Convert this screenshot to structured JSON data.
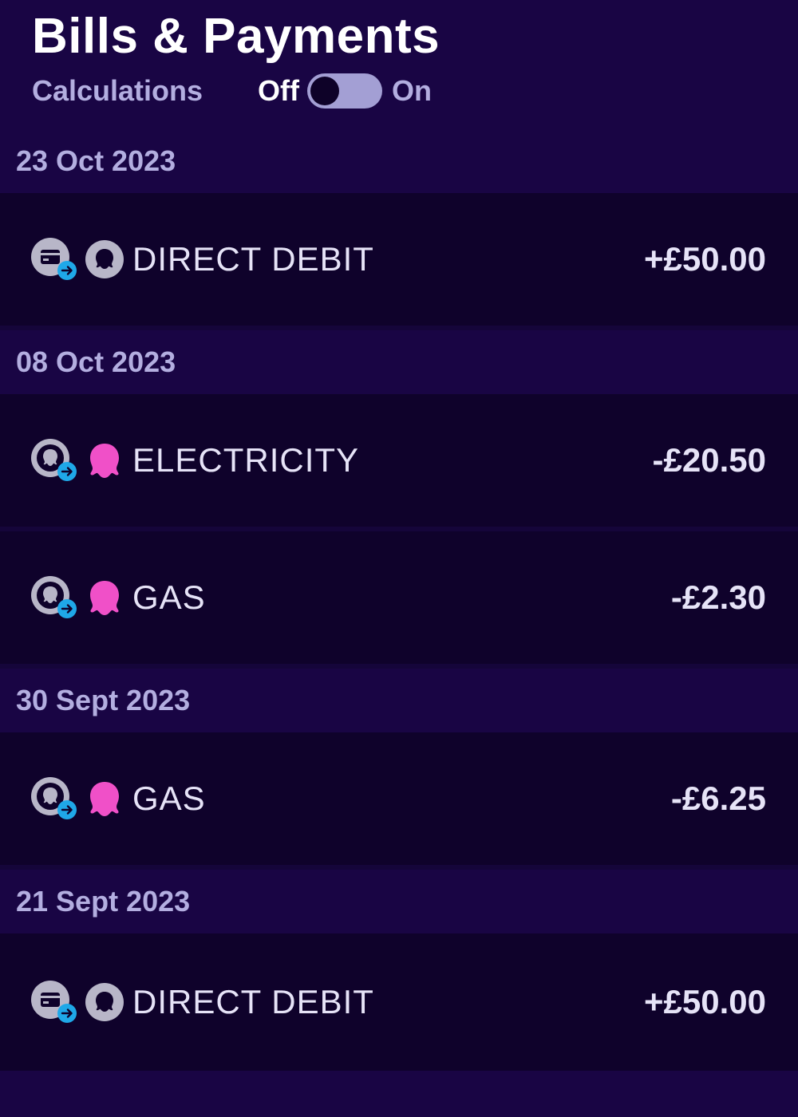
{
  "header": {
    "title": "Bills & Payments",
    "calculations_label": "Calculations",
    "toggle_off_label": "Off",
    "toggle_on_label": "On",
    "toggle_state": "off"
  },
  "colors": {
    "background": "#190544",
    "row_background": "#0f022b",
    "text_primary": "#ffffff",
    "text_secondary": "#b3aee0",
    "arrow_badge": "#1fa8e8",
    "octopus_pink": "#f050c8",
    "icon_grey": "#b8b6c8"
  },
  "groups": [
    {
      "date": "23 Oct 2023",
      "items": [
        {
          "type_icon": "card-icon",
          "brand_icon": "octopus-outline-icon",
          "label": "DIRECT DEBIT",
          "amount": "+£50.00"
        }
      ]
    },
    {
      "date": "08 Oct 2023",
      "items": [
        {
          "type_icon": "octopus-bill-icon",
          "brand_icon": "octopus-pink-icon",
          "label": "ELECTRICITY",
          "amount": "-£20.50"
        },
        {
          "type_icon": "octopus-bill-icon",
          "brand_icon": "octopus-pink-icon",
          "label": "GAS",
          "amount": "-£2.30"
        }
      ]
    },
    {
      "date": "30 Sept 2023",
      "items": [
        {
          "type_icon": "octopus-bill-icon",
          "brand_icon": "octopus-pink-icon",
          "label": "GAS",
          "amount": "-£6.25"
        }
      ]
    },
    {
      "date": "21 Sept 2023",
      "items": [
        {
          "type_icon": "card-icon",
          "brand_icon": "octopus-outline-icon",
          "label": "DIRECT DEBIT",
          "amount": "+£50.00"
        }
      ]
    }
  ]
}
